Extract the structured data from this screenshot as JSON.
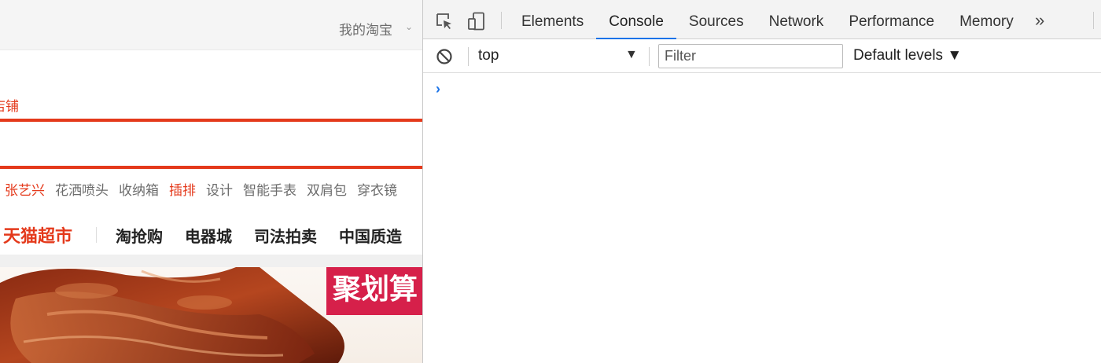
{
  "webpage": {
    "my_taobao": "我的淘宝",
    "shop_tab": "店铺",
    "hot_words": [
      {
        "text": "张艺兴",
        "highlight": true
      },
      {
        "text": "花洒喷头",
        "highlight": false
      },
      {
        "text": "收纳箱",
        "highlight": false
      },
      {
        "text": "插排",
        "highlight": true
      },
      {
        "text": "设计",
        "highlight": false
      },
      {
        "text": "智能手表",
        "highlight": false
      },
      {
        "text": "双肩包",
        "highlight": false
      },
      {
        "text": "穿衣镜",
        "highlight": false
      }
    ],
    "channels": {
      "tmall": "天猫超市",
      "items": [
        "淘抢购",
        "电器城",
        "司法拍卖",
        "中国质造"
      ]
    },
    "banner_badge": "聚划算",
    "brand_color": "#e4391b"
  },
  "devtools": {
    "tool_icons": [
      "inspect-element-icon",
      "device-toggle-icon"
    ],
    "tabs": [
      {
        "label": "Elements",
        "active": false
      },
      {
        "label": "Console",
        "active": true
      },
      {
        "label": "Sources",
        "active": false
      },
      {
        "label": "Network",
        "active": false
      },
      {
        "label": "Performance",
        "active": false
      },
      {
        "label": "Memory",
        "active": false
      }
    ],
    "more_tabs": "»",
    "console": {
      "context": "top",
      "filter_placeholder": "Filter",
      "filter_value": "",
      "levels": "Default levels ▼",
      "prompt": "›"
    },
    "accent_color": "#1a73e8"
  }
}
